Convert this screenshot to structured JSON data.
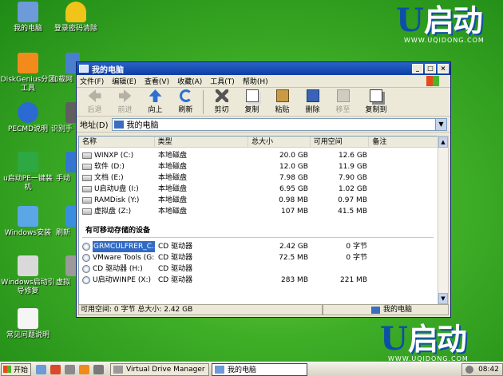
{
  "desktop_icons": [
    {
      "label": "我的电脑",
      "icon": "computer-icon",
      "color": "#6d9ad8"
    },
    {
      "label": "登录密码清除",
      "icon": "key-icon",
      "color": "#f0c419"
    },
    {
      "label": "DiskGenius分区工具",
      "icon": "diskgenius-icon",
      "color": "#f28a1c"
    },
    {
      "label": "加载网",
      "icon": "network-icon",
      "color": "#4a7fd0"
    },
    {
      "label": "PECMD说明",
      "icon": "help-icon",
      "color": "#2a6ad1"
    },
    {
      "label": "识别手",
      "icon": "device-icon",
      "color": "#5f5f5f"
    },
    {
      "label": "u启动PE一键装机",
      "icon": "u-install-icon",
      "color": "#2ea843"
    },
    {
      "label": "手动",
      "icon": "tool-icon",
      "color": "#3576d1"
    },
    {
      "label": "Windows安装",
      "icon": "windows-setup-icon",
      "color": "#5aa6e6"
    },
    {
      "label": "刷新",
      "icon": "refresh-icon",
      "color": "#3a8ee0"
    },
    {
      "label": "Windows启动引导修复",
      "icon": "repair-icon",
      "color": "#d9d9d9"
    },
    {
      "label": "虚拟",
      "icon": "virtual-drive-icon",
      "color": "#9a9a9a"
    },
    {
      "label": "常见问题说明",
      "icon": "document-icon",
      "color": "#f5f5f5"
    }
  ],
  "brand": {
    "mark": "U",
    "text": "启动",
    "url": "WWW.UQIDONG.COM"
  },
  "window": {
    "title": "我的电脑",
    "menu": [
      "文件(F)",
      "编辑(E)",
      "查看(V)",
      "收藏(A)",
      "工具(T)",
      "帮助(H)"
    ],
    "toolbar": [
      {
        "label": "后退",
        "icon": "back-arrow-icon",
        "enabled": false
      },
      {
        "label": "前进",
        "icon": "forward-arrow-icon",
        "enabled": false
      },
      {
        "label": "向上",
        "icon": "up-arrow-icon",
        "enabled": true
      },
      {
        "label": "刷新",
        "icon": "refresh-icon",
        "enabled": true
      },
      {
        "label": "剪切",
        "icon": "scissors-icon",
        "enabled": true
      },
      {
        "label": "复制",
        "icon": "copy-icon",
        "enabled": true
      },
      {
        "label": "粘贴",
        "icon": "paste-icon",
        "enabled": true
      },
      {
        "label": "删除",
        "icon": "delete-icon",
        "enabled": true
      },
      {
        "label": "移至",
        "icon": "move-to-icon",
        "enabled": false
      },
      {
        "label": "复制到",
        "icon": "copy-to-icon",
        "enabled": true
      }
    ],
    "address": {
      "label": "地址(D)",
      "value": "我的电脑"
    },
    "columns": [
      "名称",
      "类型",
      "总大小",
      "可用空间",
      "备注"
    ],
    "hard_disks": [
      {
        "name": "WINXP (C:)",
        "type": "本地磁盘",
        "total": "20.0 GB",
        "free": "12.6 GB"
      },
      {
        "name": "软件 (D:)",
        "type": "本地磁盘",
        "total": "12.0 GB",
        "free": "11.9 GB"
      },
      {
        "name": "文档 (E:)",
        "type": "本地磁盘",
        "total": "7.98 GB",
        "free": "7.90 GB"
      },
      {
        "name": "U启动U盘 (I:)",
        "type": "本地磁盘",
        "total": "6.95 GB",
        "free": "1.02 GB"
      },
      {
        "name": "RAMDisk (Y:)",
        "type": "本地磁盘",
        "total": "0.98 MB",
        "free": "0.97 MB"
      },
      {
        "name": "虚拟盘 (Z:)",
        "type": "本地磁盘",
        "total": "107 MB",
        "free": "41.5 MB"
      }
    ],
    "removable_section": "有可移动存储的设备",
    "removable": [
      {
        "name": "GRMCULFRER_C...",
        "type": "CD 驱动器",
        "total": "2.42 GB",
        "free": "0 字节"
      },
      {
        "name": "VMware Tools (G:)",
        "type": "CD 驱动器",
        "total": "72.5 MB",
        "free": "0 字节"
      },
      {
        "name": "CD 驱动器 (H:)",
        "type": "CD 驱动器",
        "total": "",
        "free": ""
      },
      {
        "name": "U启动WINPE (X:)",
        "type": "CD 驱动器",
        "total": "283 MB",
        "free": "221 MB"
      }
    ],
    "status_left": "可用空间: 0 字节 总大小: 2.42 GB",
    "status_right": "我的电脑"
  },
  "taskbar": {
    "start": "开始",
    "tasks": [
      {
        "label": "Virtual Drive Manager",
        "active": false
      },
      {
        "label": "我的电脑",
        "active": true
      }
    ],
    "clock": "08:42"
  }
}
